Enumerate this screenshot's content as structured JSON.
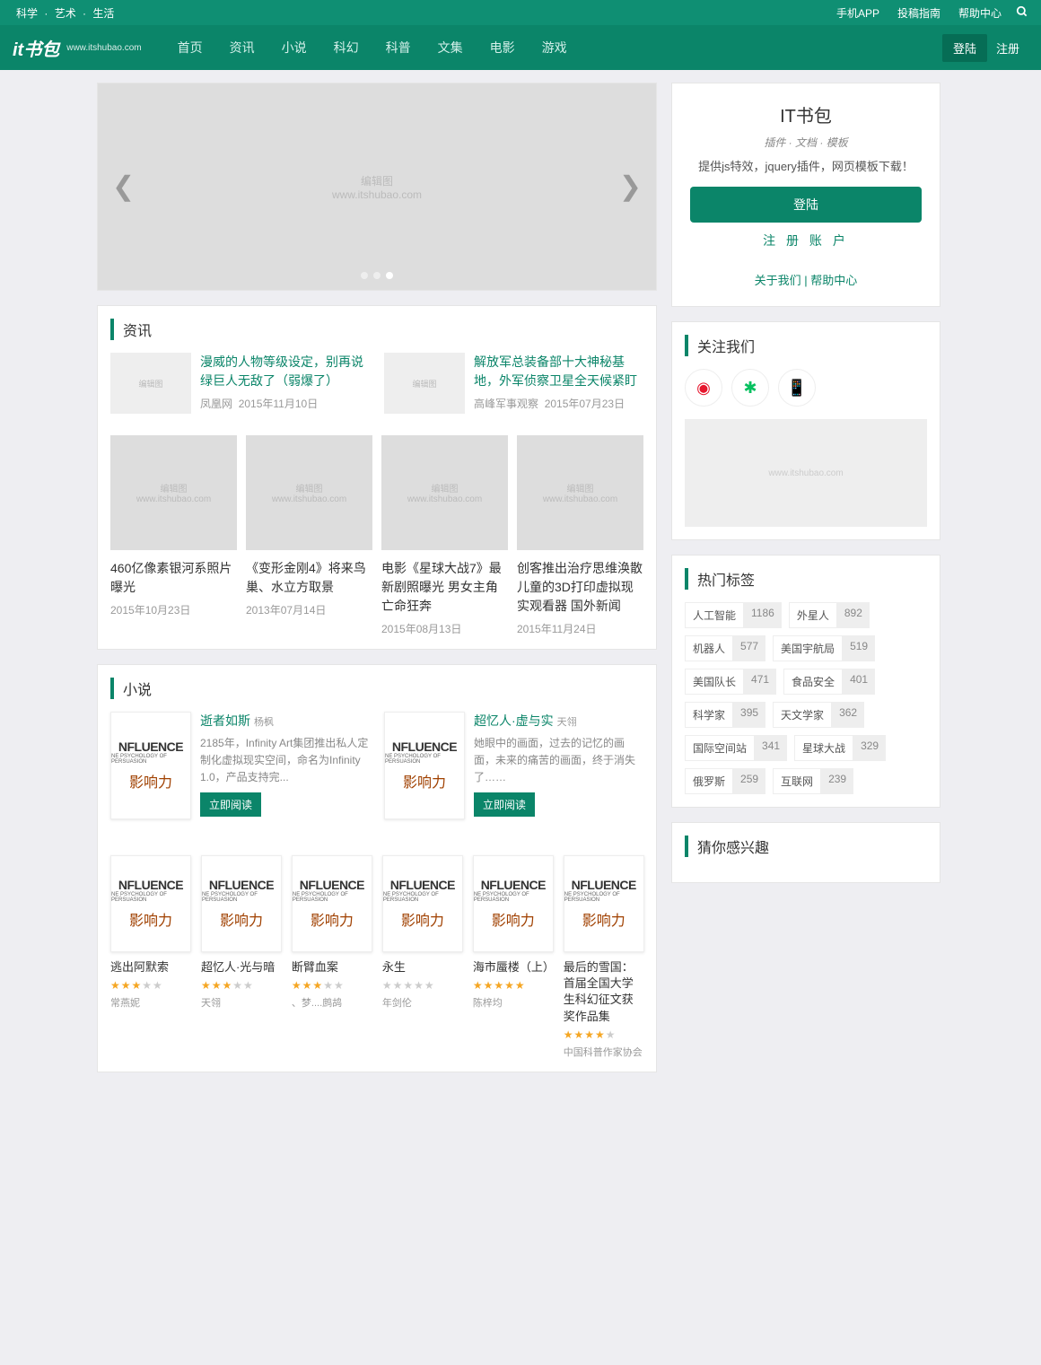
{
  "topbar": {
    "left": [
      "科学",
      "艺术",
      "生活"
    ],
    "right": [
      "手机APP",
      "投稿指南",
      "帮助中心"
    ]
  },
  "nav": {
    "logo": "it书包",
    "logo_sub": "www.itshubao.com",
    "menu": [
      "首页",
      "资讯",
      "小说",
      "科幻",
      "科普",
      "文集",
      "电影",
      "游戏"
    ],
    "login": "登陆",
    "register": "注册"
  },
  "carousel": {
    "ph1": "编辑图",
    "ph2": "www.itshubao.com"
  },
  "sections": {
    "news": {
      "title": "资讯",
      "top": [
        {
          "title": "漫威的人物等级设定，别再说绿巨人无敌了（弱爆了）",
          "source": "凤凰网",
          "date": "2015年11月10日"
        },
        {
          "title": "解放军总装备部十大神秘基地，外军侦察卫星全天候紧盯",
          "source": "高峰军事观察",
          "date": "2015年07月23日"
        }
      ],
      "grid": [
        {
          "title": "460亿像素银河系照片曝光",
          "date": "2015年10月23日"
        },
        {
          "title": "《变形金刚4》将来鸟巢、水立方取景",
          "date": "2013年07月14日"
        },
        {
          "title": "电影《星球大战7》最新剧照曝光 男女主角亡命狂奔",
          "date": "2015年08月13日"
        },
        {
          "title": "创客推出治疗思维涣散儿童的3D打印虚拟现实观看器 国外新闻",
          "date": "2015年11月24日"
        }
      ]
    },
    "novel": {
      "title": "小说",
      "featured": [
        {
          "title": "逝者如斯",
          "author": "杨枫",
          "desc": "2185年，Infinity Art集团推出私人定制化虚拟现实空间，命名为Infinity 1.0，产品支持完...",
          "btn": "立即阅读"
        },
        {
          "title": "超忆人·虚与实",
          "author": "天翎",
          "desc": "她眼中的画面，过去的记忆的画面，未来的痛苦的画面，终于消失了……",
          "btn": "立即阅读"
        }
      ],
      "grid": [
        {
          "title": "逃出阿默索",
          "author": "常燕妮",
          "stars": 3
        },
        {
          "title": "超忆人·光与暗",
          "author": "天翎",
          "stars": 3
        },
        {
          "title": "断臂血案",
          "author": "、梦....鹧鸪",
          "stars": 3
        },
        {
          "title": "永生",
          "author": "年剑伦",
          "stars": 0
        },
        {
          "title": "海市蜃楼（上）",
          "author": "陈梓均",
          "stars": 5
        },
        {
          "title": "最后的雪国：首届全国大学生科幻征文获奖作品集",
          "author": "中国科普作家协会",
          "stars": 4
        }
      ]
    }
  },
  "side": {
    "intro": {
      "title": "IT书包",
      "tagline": "插件 · 文档 · 模板",
      "brief": "提供js特效，jquery插件，网页模板下载！",
      "login": "登陆",
      "register": "注 册 账 户",
      "about": "关于我们",
      "help": "帮助中心"
    },
    "follow": {
      "title": "关注我们",
      "ad": "www.itshubao.com"
    },
    "tags": {
      "title": "热门标签",
      "items": [
        {
          "n": "人工智能",
          "c": "1186"
        },
        {
          "n": "外星人",
          "c": "892"
        },
        {
          "n": "机器人",
          "c": "577"
        },
        {
          "n": "美国宇航局",
          "c": "519"
        },
        {
          "n": "美国队长",
          "c": "471"
        },
        {
          "n": "食品安全",
          "c": "401"
        },
        {
          "n": "科学家",
          "c": "395"
        },
        {
          "n": "天文学家",
          "c": "362"
        },
        {
          "n": "国际空间站",
          "c": "341"
        },
        {
          "n": "星球大战",
          "c": "329"
        },
        {
          "n": "俄罗斯",
          "c": "259"
        },
        {
          "n": "互联网",
          "c": "239"
        }
      ]
    },
    "interest": {
      "title": "猜你感兴趣"
    }
  },
  "cover": {
    "inf": "NFLUENCE",
    "sub": "NE PSYCHOLOGY OF PERSUASION",
    "cn": "影响力"
  }
}
